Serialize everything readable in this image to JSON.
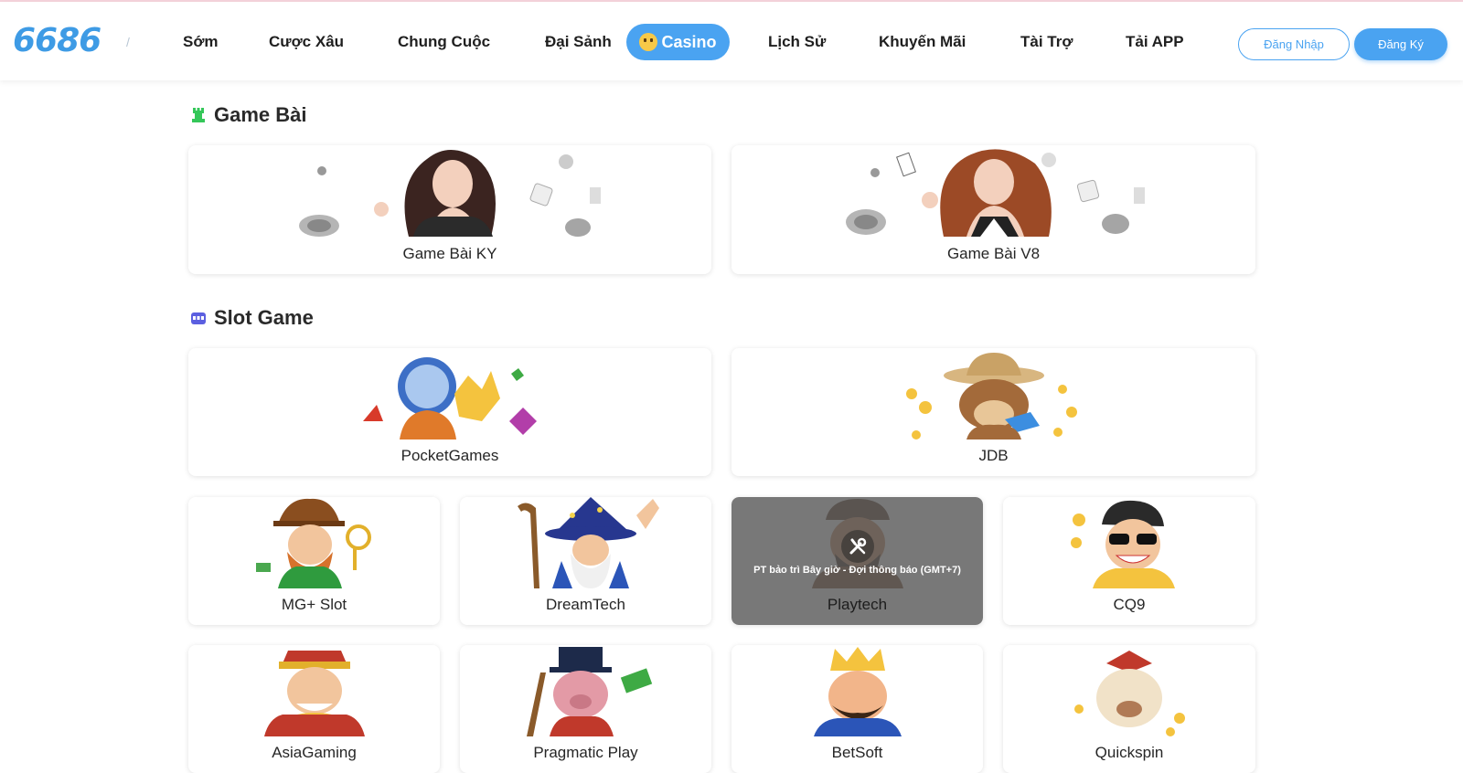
{
  "header": {
    "logo": "6686",
    "nav": [
      "Sớm",
      "Cược Xâu",
      "Chung Cuộc",
      "Đại Sảnh",
      "Lịch Sử",
      "Khuyến Mãi",
      "Tài Trợ",
      "Tải APP"
    ],
    "casino_label": "Casino",
    "login_label": "Đăng Nhập",
    "register_label": "Đăng Ký"
  },
  "sections": [
    {
      "title": "Game Bài",
      "icon": "rook-icon",
      "cards": [
        {
          "label": "Game Bài KY",
          "art": "girl-dealer-art"
        },
        {
          "label": "Game Bài V8",
          "art": "girl-cards-art"
        }
      ]
    },
    {
      "title": "Slot Game",
      "icon": "slot-machine-icon",
      "cards": [
        {
          "label": "PocketGames",
          "art": "astronaut-art"
        },
        {
          "label": "JDB",
          "art": "cowboy-dog-art"
        },
        {
          "label": "MG+ Slot",
          "art": "leprechaun-art"
        },
        {
          "label": "DreamTech",
          "art": "wizard-art"
        },
        {
          "label": "Playtech",
          "art": "pirate-art",
          "maintenance": "PT bảo trì Bây giờ - Đợi thông báo (GMT+7)"
        },
        {
          "label": "CQ9",
          "art": "sunglasses-man-art"
        },
        {
          "label": "AsiaGaming",
          "art": "fortune-god-art"
        },
        {
          "label": "Pragmatic Play",
          "art": "pig-art"
        },
        {
          "label": "BetSoft",
          "art": "king-art"
        },
        {
          "label": "Quickspin",
          "art": "dog-art"
        }
      ]
    }
  ],
  "colors": {
    "accent": "#4aa3f1",
    "logo": "#3e9be5",
    "rook": "#34c759",
    "slot": "#5b5fe0"
  }
}
